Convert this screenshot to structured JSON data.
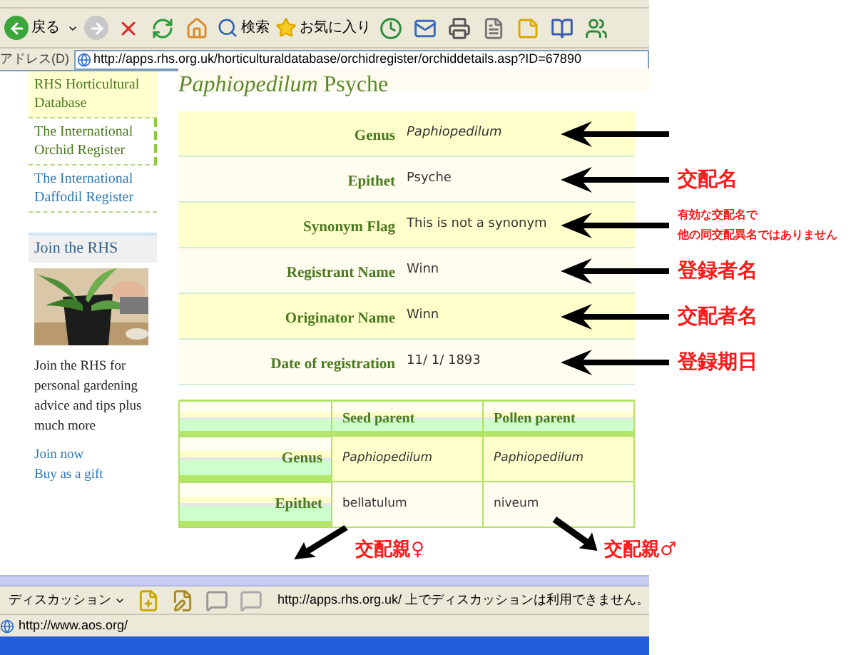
{
  "toolbar": {
    "back": "戻る",
    "search": "検索",
    "favorites": "お気に入り"
  },
  "address_bar": {
    "label": "アドレス(D)",
    "url": "http://apps.rhs.org.uk/horticulturaldatabase/orchidregister/orchiddetails.asp?ID=67890"
  },
  "sidebar": {
    "items": [
      {
        "label": "RHS Horticultural Database",
        "kind": "section",
        "selected": false
      },
      {
        "label": "The International Orchid Register",
        "kind": "section",
        "selected": true
      },
      {
        "label": "The International Daffodil Register",
        "kind": "link",
        "selected": false
      }
    ]
  },
  "join": {
    "title": "Join the RHS",
    "picture": {
      "kind": "picture"
    },
    "text": "Join the RHS for personal gardening advice and tips plus much more",
    "links": [
      "Join now",
      "Buy as a gift"
    ]
  },
  "title": "*Paphiopedilum* Psyche",
  "details": [
    {
      "label": "Genus",
      "value": "Paphiopedilum",
      "italic": true,
      "note": {
        "kind": "none"
      }
    },
    {
      "label": "Epithet",
      "value": "Psyche",
      "italic": false,
      "note": {
        "kind": "large",
        "lines": [
          "交配名"
        ]
      }
    },
    {
      "label": "Synonym Flag",
      "value": "This is not a synonym",
      "italic": false,
      "note": {
        "kind": "small",
        "lines": [
          "有効な交配名で",
          "他の同交配異名ではありません"
        ]
      }
    },
    {
      "label": "Registrant Name",
      "value": "Winn",
      "italic": false,
      "note": {
        "kind": "large",
        "lines": [
          "登録者名"
        ]
      }
    },
    {
      "label": "Originator Name",
      "value": "Winn",
      "italic": false,
      "note": {
        "kind": "large",
        "lines": [
          "交配者名"
        ]
      }
    },
    {
      "label": "Date of registration",
      "value": "11/ 1/ 1893",
      "italic": false,
      "note": {
        "kind": "large",
        "lines": [
          "登録期日"
        ]
      }
    }
  ],
  "parents": {
    "columns": [
      "Seed parent",
      "Pollen parent"
    ],
    "rows": [
      {
        "label": "Genus",
        "values": [
          "Paphiopedilum",
          "Paphiopedilum"
        ],
        "italic": true
      },
      {
        "label": "Epithet",
        "values": [
          "bellatulum",
          "niveum"
        ],
        "italic": false
      }
    ]
  },
  "parent_notes": [
    "交配親♀",
    "交配親♂"
  ],
  "discussion_bar": {
    "label": "ディスカッション",
    "message": "http://apps.rhs.org.uk/ 上でディスカッションは利用できません。"
  },
  "status_bar": {
    "url": "http://www.aos.org/"
  }
}
